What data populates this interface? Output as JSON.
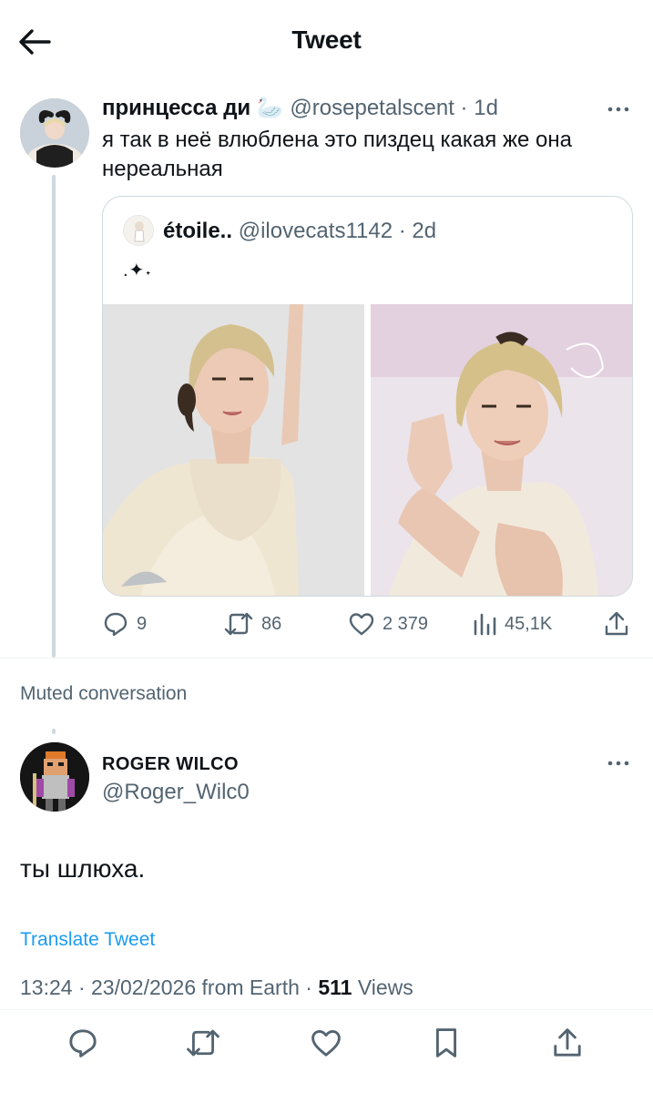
{
  "header": {
    "title": "Tweet",
    "back_icon": "arrow-left-icon"
  },
  "parent_tweet": {
    "display_name": "принцесса ди",
    "emoji": "🦢",
    "handle": "@rosepetalscent",
    "age": "1d",
    "text": "я так в неё влюблена это пиздец какая же она нереальная",
    "quote": {
      "display_name": "étoile..",
      "handle": "@ilovecats1142",
      "age": "2d",
      "text": ".✦˖"
    },
    "stats": {
      "replies": "9",
      "retweets": "86",
      "likes": "2 379",
      "views": "45,1K"
    }
  },
  "muted_label": "Muted conversation",
  "reply": {
    "display_name": "ROGER WILCO",
    "handle": "@Roger_Wilc0",
    "text": "ты шлюха.",
    "translate_label": "Translate Tweet",
    "time": "13:24",
    "date": "23/02/2026",
    "source": "from Earth",
    "views_count": "511",
    "views_label": "Views"
  },
  "colors": {
    "text": "#0f1419",
    "muted": "#536471",
    "link": "#1d9bf0",
    "border": "#cfd9de"
  }
}
